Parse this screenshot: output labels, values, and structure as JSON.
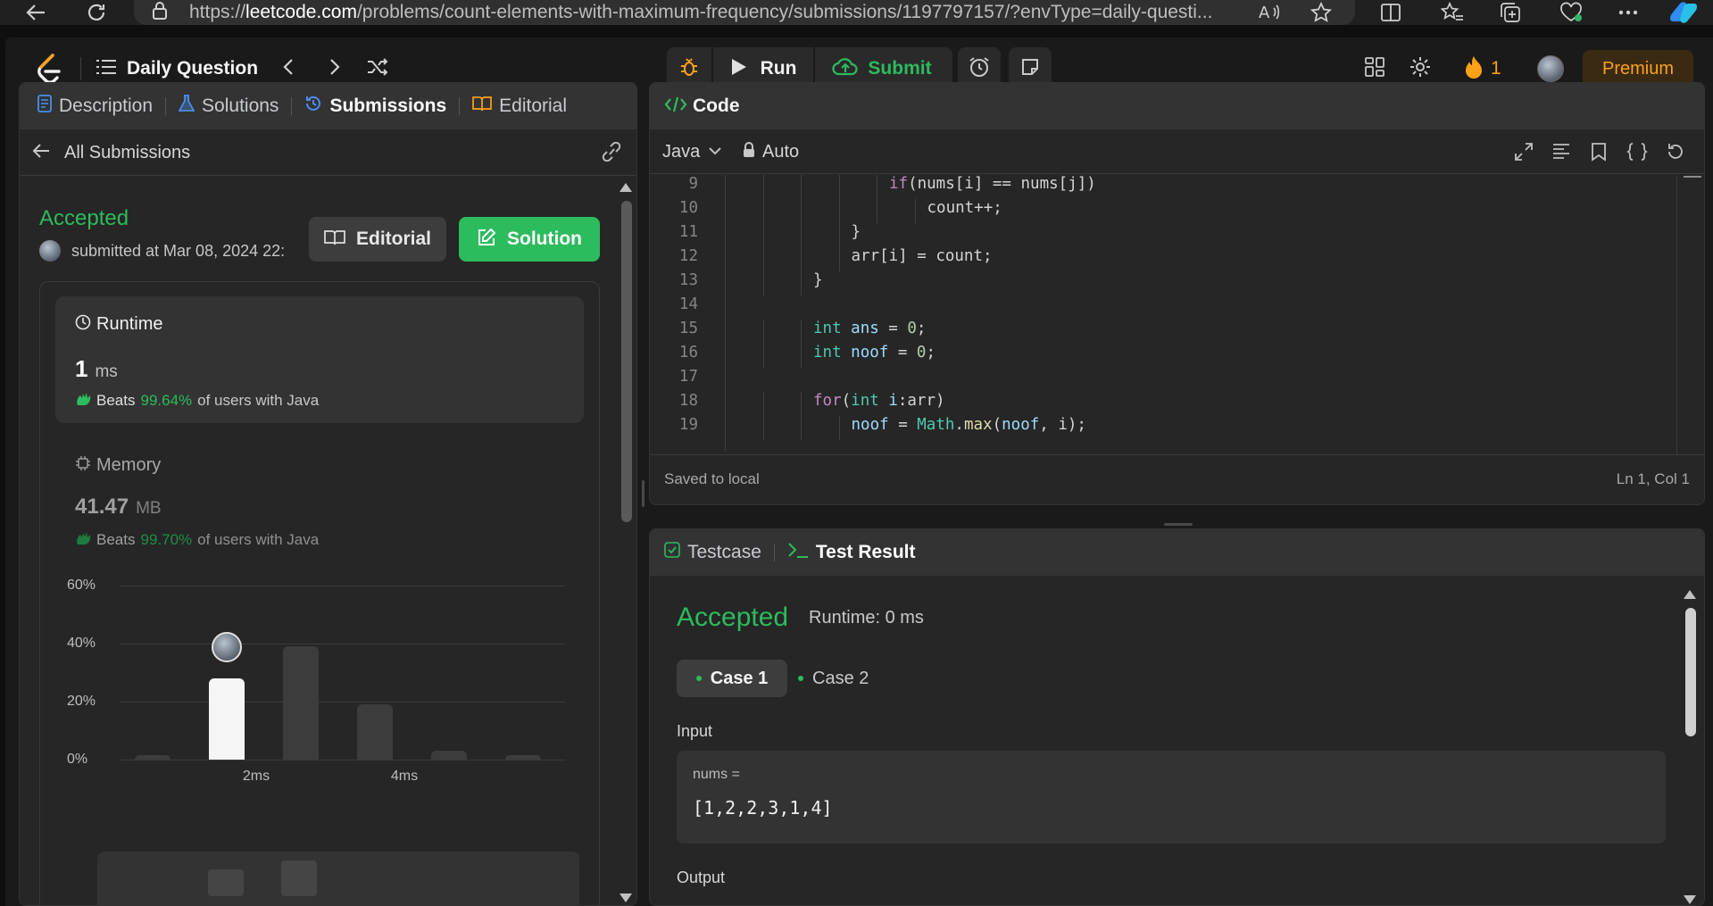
{
  "browser": {
    "url_domain": "leetcode.com",
    "url_rest": "/problems/count-elements-with-maximum-frequency/submissions/1197797157/?envType=daily-questi...",
    "url_prefix": "https://"
  },
  "topnav": {
    "problem_list_label": "Daily Question",
    "run_label": "Run",
    "submit_label": "Submit",
    "streak_count": "1",
    "premium_label": "Premium"
  },
  "left_panel": {
    "tabs": [
      {
        "label": "Description",
        "icon": "document-icon"
      },
      {
        "label": "Solutions",
        "icon": "flask-icon"
      },
      {
        "label": "Submissions",
        "icon": "history-icon"
      },
      {
        "label": "Editorial",
        "icon": "book-icon"
      }
    ],
    "back_label": "All Submissions",
    "status": "Accepted",
    "submitted_text": "submitted at Mar 08, 2024 22:",
    "editorial_button": "Editorial",
    "solution_button": "Solution",
    "runtime": {
      "title": "Runtime",
      "value": "1",
      "unit": "ms",
      "beats_prefix": "Beats",
      "beats_pct": "99.64%",
      "beats_suffix": "of users with Java"
    },
    "memory": {
      "title": "Memory",
      "value": "41.47",
      "unit": "MB",
      "beats_prefix": "Beats",
      "beats_pct": "99.70%",
      "beats_suffix": "of users with Java"
    }
  },
  "chart_data": {
    "type": "bar",
    "yticks": [
      "60%",
      "40%",
      "20%",
      "0%"
    ],
    "ylim": [
      0,
      60
    ],
    "xticks": [
      "2ms",
      "4ms"
    ],
    "values": [
      1,
      28,
      39,
      19,
      3,
      1
    ],
    "highlight_index": 1,
    "colors": {
      "bar": "#3c3c3c",
      "highlight": "#f5f5f5",
      "grid": "#3a3a3a"
    }
  },
  "code_panel": {
    "title": "Code",
    "language": "Java",
    "mode": "Auto",
    "footer_left": "Saved to local",
    "footer_right": "Ln 1, Col 1",
    "lines": [
      {
        "n": "9",
        "text": "if(nums[i] == nums[j])"
      },
      {
        "n": "10",
        "text": "count++;"
      },
      {
        "n": "11",
        "text": "}"
      },
      {
        "n": "12",
        "text": "arr[i] = count;"
      },
      {
        "n": "13",
        "text": "}"
      },
      {
        "n": "14",
        "text": ""
      },
      {
        "n": "15",
        "text": "int ans = 0;"
      },
      {
        "n": "16",
        "text": "int noof = 0;"
      },
      {
        "n": "17",
        "text": ""
      },
      {
        "n": "18",
        "text": "for(int i:arr)"
      },
      {
        "n": "19",
        "text": "noof = Math.max(noof, i);"
      }
    ]
  },
  "test_panel": {
    "tab_testcase": "Testcase",
    "tab_result": "Test Result",
    "status": "Accepted",
    "runtime": "Runtime: 0 ms",
    "cases": [
      "Case 1",
      "Case 2"
    ],
    "input_label": "Input",
    "input_var": "nums =",
    "input_value": "[1,2,2,3,1,4]",
    "output_label": "Output"
  }
}
